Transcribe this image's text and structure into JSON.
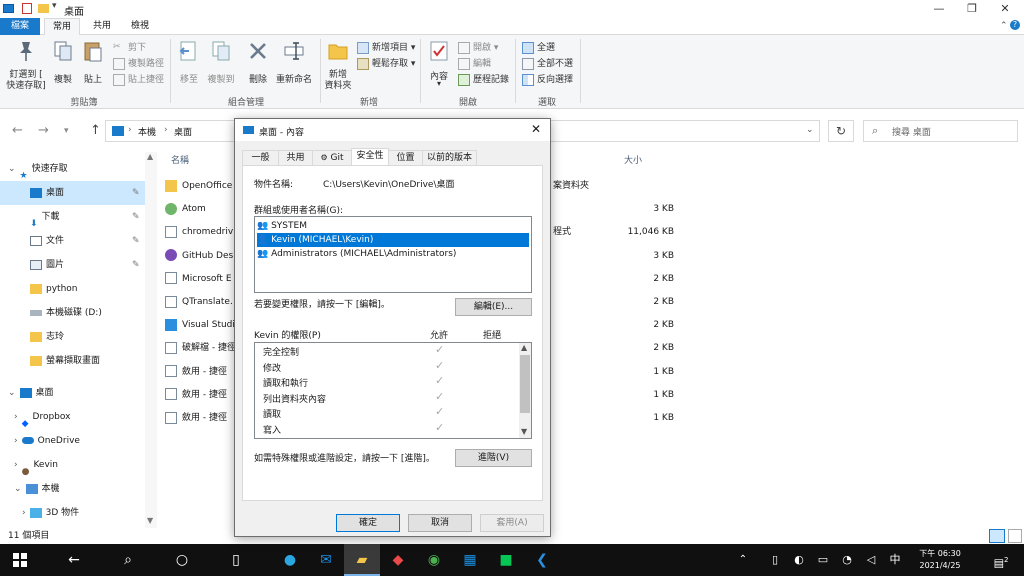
{
  "window": {
    "title": "桌面"
  },
  "ribbon_tabs": [
    "檔案",
    "常用",
    "共用",
    "檢視"
  ],
  "ribbon": {
    "pin": "釘選到 [",
    "pin2": "快速存取]",
    "copy": "複製",
    "paste": "貼上",
    "cut": "剪下",
    "copy_path": "複製路徑",
    "paste_shortcut": "貼上捷徑",
    "move_to": "移至",
    "copy_to": "複製到",
    "delete": "刪除",
    "rename": "重新命名",
    "new_item": "新增項目 ▾",
    "easy_access": "輕鬆存取 ▾",
    "new_folder": "新增",
    "new_folder2": "資料夾",
    "properties": "內容",
    "open": "開啟 ▾",
    "edit": "編輯",
    "history": "歷程記錄",
    "select_all": "全選",
    "select_none": "全部不選",
    "invert_select": "反向選擇",
    "group_clipboard": "剪貼簿",
    "group_organize": "組合管理",
    "group_new": "新增",
    "group_open": "開啟",
    "group_select": "選取"
  },
  "address": {
    "crumb1": "本機",
    "crumb2": "桌面",
    "search_placeholder": "搜尋 桌面"
  },
  "nav": [
    {
      "label": "快速存取"
    },
    {
      "label": "桌面"
    },
    {
      "label": "下載"
    },
    {
      "label": "文件"
    },
    {
      "label": "圖片"
    },
    {
      "label": "python"
    },
    {
      "label": "本機磁碟 (D:)"
    },
    {
      "label": "志玲"
    },
    {
      "label": "螢幕擷取畫面"
    },
    {
      "label": "桌面"
    },
    {
      "label": "Dropbox"
    },
    {
      "label": "OneDrive"
    },
    {
      "label": "Kevin"
    },
    {
      "label": "本機"
    },
    {
      "label": "3D 物件"
    }
  ],
  "files": {
    "header_name": "名稱",
    "header_size": "大小",
    "rows": [
      {
        "name": "OpenOffice",
        "type": "案資料夾",
        "size": ""
      },
      {
        "name": "Atom",
        "type": "",
        "size": "3 KB"
      },
      {
        "name": "chromedriv",
        "type": "程式",
        "size": "11,046 KB"
      },
      {
        "name": "GitHub Des",
        "type": "",
        "size": "3 KB"
      },
      {
        "name": "Microsoft E",
        "type": "",
        "size": "2 KB"
      },
      {
        "name": "QTranslate.",
        "type": "",
        "size": "2 KB"
      },
      {
        "name": "Visual Studi",
        "type": "",
        "size": "2 KB"
      },
      {
        "name": "破解檔 - 捷徑",
        "type": "",
        "size": "2 KB"
      },
      {
        "name": "斂用 - 捷徑",
        "type": "",
        "size": "1 KB"
      },
      {
        "name": "斂用 - 捷徑",
        "type": "",
        "size": "1 KB"
      },
      {
        "name": "斂用 - 捷徑",
        "type": "",
        "size": "1 KB"
      }
    ]
  },
  "status": {
    "count": "11 個項目"
  },
  "dialog": {
    "title": "桌面 - 內容",
    "tabs": [
      "一般",
      "共用",
      "Git",
      "安全性",
      "位置",
      "以前的版本"
    ],
    "object_label": "物件名稱:",
    "object_value": "C:\\Users\\Kevin\\OneDrive\\桌面",
    "groups_label": "群組或使用者名稱(G):",
    "users": [
      "SYSTEM",
      "Kevin (MICHAEL\\Kevin)",
      "Administrators (MICHAEL\\Administrators)"
    ],
    "change_hint": "若要變更權限，請按一下 [編輯]。",
    "edit_button": "編輯(E)...",
    "perm_label": "Kevin 的權限(P)",
    "allow": "允許",
    "deny": "拒絕",
    "permissions": [
      "完全控制",
      "修改",
      "讀取和執行",
      "列出資料夾內容",
      "讀取",
      "寫入"
    ],
    "check": "✓",
    "advanced_hint": "如需特殊權限或進階設定，請按一下 [進階]。",
    "advanced_button": "進階(V)",
    "ok": "確定",
    "cancel": "取消",
    "apply": "套用(A)"
  },
  "taskbar": {
    "ime": "中",
    "time": "下午 06:30",
    "date": "2021/4/25",
    "notify": "2"
  },
  "colors": {
    "accent": "#1979ca",
    "selection": "#cce8ff",
    "dialog_select": "#0078d7"
  }
}
